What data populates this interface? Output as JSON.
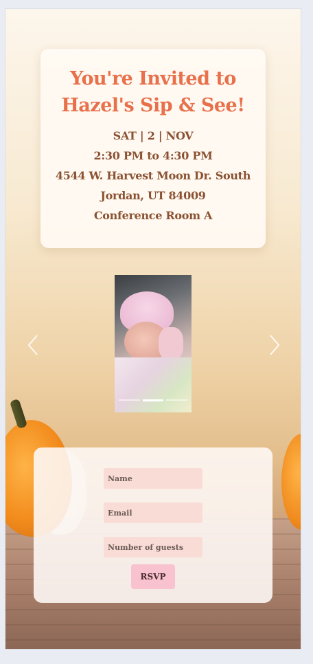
{
  "invitation": {
    "title_line1": "You're Invited to",
    "title_line2": "Hazel's Sip & See!",
    "date": "SAT | 2 | NOV",
    "time": "2:30 PM to 4:30 PM",
    "address_line1": "4544 W. Harvest Moon Dr. South",
    "address_line2": "Jordan, UT 84009",
    "room": "Conference Room A"
  },
  "carousel": {
    "slide_count": 3,
    "active_index": 1
  },
  "rsvp_form": {
    "name_placeholder": "Name",
    "email_placeholder": "Email",
    "guests_placeholder": "Number of guests",
    "submit_label": "RSVP"
  },
  "colors": {
    "title": "#e8704a",
    "details": "#8a5232",
    "input_bg": "#f9dcd5",
    "button_bg": "#f8c2cf"
  }
}
